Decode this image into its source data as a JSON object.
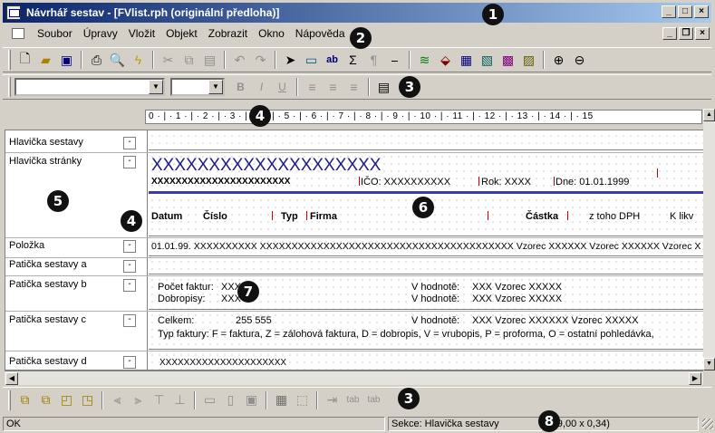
{
  "window": {
    "title": "Návrhář sestav - [FVlist.rph (originální předloha)]"
  },
  "menu": [
    "Soubor",
    "Úpravy",
    "Vložit",
    "Objekt",
    "Zobrazit",
    "Okno",
    "Nápověda"
  ],
  "icons": {
    "toolbar_main": [
      "new-doc-icon",
      "open-folder-icon",
      "save-icon",
      "print-icon",
      "print-preview-icon",
      "lightning-icon",
      "cut-icon",
      "copy-icon",
      "paste-icon",
      "undo-icon",
      "redo-icon",
      "pointer-icon",
      "text-field-icon",
      "text-ab-icon",
      "sum-icon",
      "paragraph-icon",
      "line-icon",
      "format-icon",
      "stamp-icon",
      "field-icon",
      "field2-icon",
      "field3-icon",
      "field4-icon",
      "zoom-in-icon",
      "zoom-out-icon"
    ],
    "toolbar_format": [
      "bold-icon",
      "italic-icon",
      "underline-icon",
      "align-left-icon",
      "align-center-icon",
      "align-right-icon",
      "properties-icon"
    ],
    "toolbar_bottom": [
      "bring-front-icon",
      "send-back-icon",
      "group-icon",
      "ungroup-icon",
      "align-left-objs-icon",
      "align-right-objs-icon",
      "align-top-objs-icon",
      "align-bottom-objs-icon",
      "size-width-icon",
      "size-height-icon",
      "size-both-icon",
      "grid-icon",
      "frame-icon",
      "tab-order-icon",
      "tab-icon",
      "tab-select-icon"
    ]
  },
  "ruler": {
    "text": "0 · | · 1 · | · 2 · | · 3 · | · 4 · | · 5 · | · 6 · | · 7 · | · 8 · | · 9 · | · 10 · | · 11 · | · 12 · | · 13 · | · 14 · | · 15"
  },
  "sections": [
    {
      "label": "Hlavička sestavy",
      "toggle": "-"
    },
    {
      "label": "Hlavička stránky",
      "toggle": "-"
    },
    {
      "label": "Položka",
      "toggle": "-"
    },
    {
      "label": "Patička sestavy a",
      "toggle": "-"
    },
    {
      "label": "Patička sestavy b",
      "toggle": "-"
    },
    {
      "label": "Patička sestavy c",
      "toggle": "-"
    },
    {
      "label": "Patička sestavy d",
      "toggle": "-"
    }
  ],
  "page_header": {
    "big_placeholder": "XXXXXXXXXXXXXXXXXXXX",
    "small_placeholder": "XXXXXXXXXXXXXXXXXXXXXXX",
    "ico": "IČO: XXXXXXXXXX",
    "rok": "Rok: XXXX",
    "dne": "Dne: 01.01.1999",
    "columns": [
      "Datum",
      "Číslo",
      "Typ",
      "Firma",
      "Částka",
      "z toho DPH",
      "K likv"
    ]
  },
  "item_row": "01.01.99. XXXXXXXXXX XXXXXXXXXXXXXXXXXXXXXXXXXXXXXXXXXXXXXXXX Vzorec XXXXXX Vzorec XXXXXX Vzorec X",
  "footer_b": {
    "line1": "Počet faktur:",
    "line1_val": "XXX",
    "line2": "Dobropisy:",
    "line2_val": "XXX",
    "hodnote1": "V hodnotě:",
    "vzorec1": "XXX Vzorec XXXXX",
    "hodnote2": "V hodnotě:",
    "vzorec2": "XXX Vzorec XXXXX"
  },
  "footer_c": {
    "celkem": "Celkem:",
    "celkem_val": "255 555",
    "hodnote": "V hodnotě:",
    "vzorec": "XXX Vzorec XXXXXX Vzorec XXXXX",
    "legend": "Typ faktury: F = faktura, Z = zálohová faktura, D = dobropis, V = vrubopis, P = proforma, O = ostatní pohledávka,"
  },
  "footer_d": {
    "placeholder": "XXXXXXXXXXXXXXXXXXXXX"
  },
  "status": {
    "state": "OK",
    "section": "Sekce: Hlavička sestavy",
    "size": "(19,00 x 0,34)"
  },
  "callouts": [
    "1",
    "2",
    "3",
    "4",
    "5",
    "6",
    "4",
    "7",
    "3",
    "8"
  ]
}
